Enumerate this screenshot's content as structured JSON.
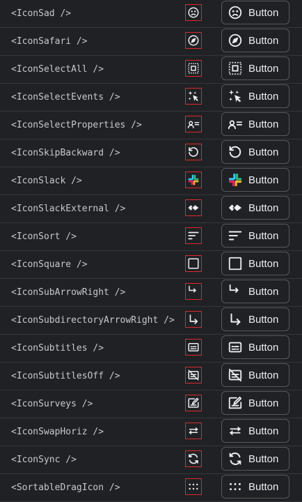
{
  "rows": [
    {
      "name": "<IconSad />",
      "icon": "sad-face-icon",
      "button_label": "Button"
    },
    {
      "name": "<IconSafari />",
      "icon": "safari-compass-icon",
      "button_label": "Button"
    },
    {
      "name": "<IconSelectAll />",
      "icon": "select-all-icon",
      "button_label": "Button"
    },
    {
      "name": "<IconSelectEvents />",
      "icon": "select-events-icon",
      "button_label": "Button"
    },
    {
      "name": "<IconSelectProperties />",
      "icon": "select-properties-icon",
      "button_label": "Button"
    },
    {
      "name": "<IconSkipBackward />",
      "icon": "skip-backward-icon",
      "button_label": "Button"
    },
    {
      "name": "<IconSlack />",
      "icon": "slack-icon",
      "button_label": "Button"
    },
    {
      "name": "<IconSlackExternal />",
      "icon": "slack-external-icon",
      "button_label": "Button"
    },
    {
      "name": "<IconSort />",
      "icon": "sort-icon",
      "button_label": "Button"
    },
    {
      "name": "<IconSquare />",
      "icon": "square-icon",
      "button_label": "Button"
    },
    {
      "name": "<IconSubArrowRight />",
      "icon": "sub-arrow-right-icon",
      "button_label": "Button"
    },
    {
      "name": "<IconSubdirectoryArrowRight />",
      "icon": "subdirectory-arrow-right-icon",
      "button_label": "Button"
    },
    {
      "name": "<IconSubtitles />",
      "icon": "subtitles-icon",
      "button_label": "Button"
    },
    {
      "name": "<IconSubtitlesOff />",
      "icon": "subtitles-off-icon",
      "button_label": "Button"
    },
    {
      "name": "<IconSurveys />",
      "icon": "surveys-icon",
      "button_label": "Button"
    },
    {
      "name": "<IconSwapHoriz />",
      "icon": "swap-horiz-icon",
      "button_label": "Button"
    },
    {
      "name": "<IconSync />",
      "icon": "sync-icon",
      "button_label": "Button"
    },
    {
      "name": "<SortableDragIcon />",
      "icon": "sortable-drag-icon",
      "button_label": "Button"
    }
  ],
  "colors": {
    "background": "#202124",
    "text": "#c7c9cd",
    "preview_border": "#d92b2b",
    "button_border": "#55585e",
    "slack_blue": "#36c5f0",
    "slack_green": "#2eb67d",
    "slack_red": "#e01e5a",
    "slack_yellow": "#ecb22e"
  }
}
